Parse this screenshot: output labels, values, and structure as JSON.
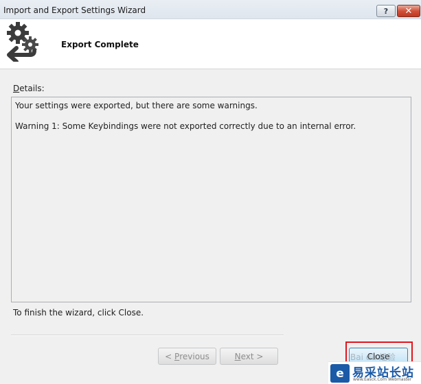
{
  "window": {
    "title": "Import and Export Settings Wizard",
    "help_glyph": "?",
    "close_glyph": "✕"
  },
  "header": {
    "title": "Export Complete",
    "icon": "gears-export-icon"
  },
  "details": {
    "label_mnemonic": "D",
    "label_rest": "etails:",
    "lines": [
      "Your settings were exported, but there are some warnings.",
      "Warning 1:  Some Keybindings were not exported correctly due to an internal error."
    ]
  },
  "finish_text": "To finish the wizard, click Close.",
  "buttons": {
    "previous_prefix": "< ",
    "previous_mnemonic": "P",
    "previous_rest": "revious",
    "next_mnemonic": "N",
    "next_rest": "ext >",
    "close_label": "Close"
  },
  "watermark": {
    "baidu": "Bai du 经验",
    "title": "易采站长站",
    "url": "www.Easck.Com Webmaster",
    "logo_glyph": "e"
  },
  "colors": {
    "highlight": "#e0141b",
    "accent": "#3c7fb1",
    "watermark_blue": "#1b5aa7"
  }
}
